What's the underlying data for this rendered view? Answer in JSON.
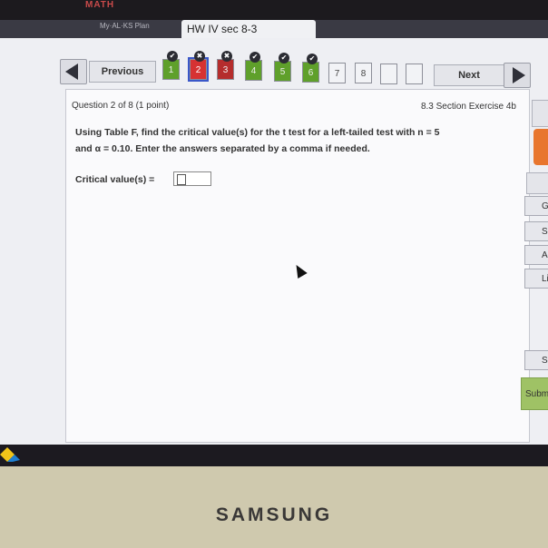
{
  "bezel": {
    "brand": "MATH"
  },
  "browser": {
    "inactive_tab": "My·AL·KS Plan",
    "active_tab": "HW IV sec 8-3"
  },
  "nav": {
    "previous_label": "Previous",
    "next_label": "Next",
    "questions": [
      {
        "number": "1",
        "status": "correct"
      },
      {
        "number": "2",
        "status": "current-incorrect"
      },
      {
        "number": "3",
        "status": "incorrect"
      },
      {
        "number": "4",
        "status": "correct"
      },
      {
        "number": "5",
        "status": "correct"
      },
      {
        "number": "6",
        "status": "correct"
      },
      {
        "number": "7",
        "status": "unanswered"
      },
      {
        "number": "8",
        "status": "unanswered"
      }
    ]
  },
  "question": {
    "header": "Question 2 of 8 (1 point)",
    "section": "8.3 Section Exercise 4b",
    "text_line1": "Using Table F, find the critical value(s) for the t test for a left-tailed test with n = 5",
    "text_line2": "and α = 0.10. Enter the answers separated by a comma if needed.",
    "answer_label": "Critical value(s) =",
    "answer_value": ""
  },
  "side_panel": {
    "btn_g": "G",
    "btn_s": "S",
    "btn_as": "As",
    "btn_li": "Lir",
    "btn_sa": "Sa",
    "btn_submit": "Subm"
  },
  "monitor": {
    "maker": "SAMSUNG"
  },
  "colors": {
    "correct": "#5fa02b",
    "incorrect": "#b52d2d",
    "current_outline": "#3a57c9",
    "submit": "#9fc265",
    "orange_tab": "#e8762e"
  }
}
